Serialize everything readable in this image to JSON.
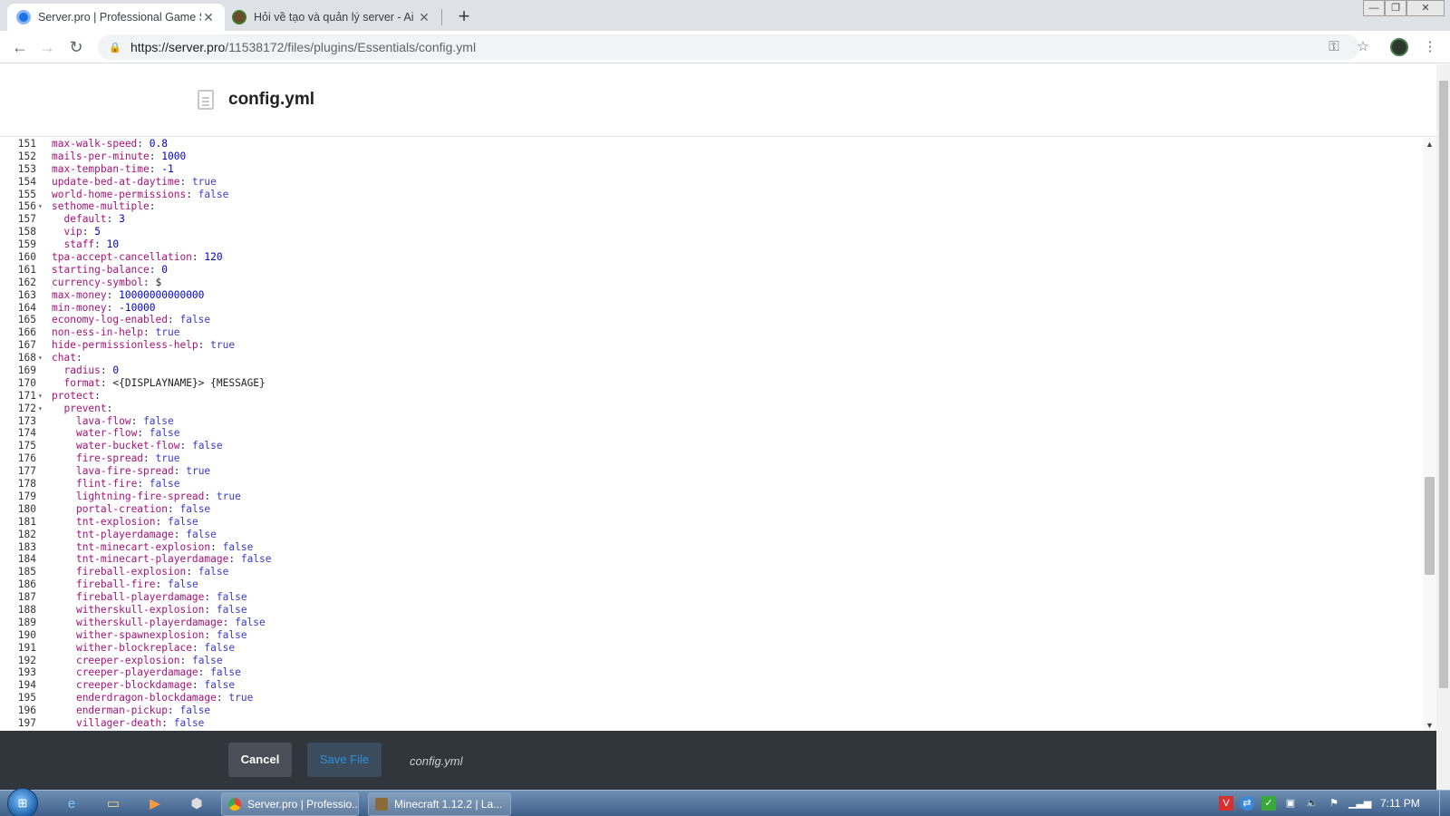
{
  "browser": {
    "tabs": [
      {
        "title": "Server.pro | Professional Game S",
        "active": true
      },
      {
        "title": "Hỏi về tạo và quản lý server - Ai",
        "active": false
      }
    ],
    "new_tab_icon": "plus-icon",
    "url_host": "https://server.pro",
    "url_path": "/11538172/files/plugins/Essentials/config.yml"
  },
  "page": {
    "file_title": "config.yml"
  },
  "editor": {
    "lines": [
      {
        "n": "151",
        "fold": "",
        "indent": "",
        "key": "max-walk-speed",
        "val": "0.8",
        "type": "num"
      },
      {
        "n": "152",
        "fold": "",
        "indent": "",
        "key": "mails-per-minute",
        "val": "1000",
        "type": "num"
      },
      {
        "n": "153",
        "fold": "",
        "indent": "",
        "key": "max-tempban-time",
        "val": "-1",
        "type": "num"
      },
      {
        "n": "154",
        "fold": "",
        "indent": "",
        "key": "update-bed-at-daytime",
        "val": "true",
        "type": "bool"
      },
      {
        "n": "155",
        "fold": "",
        "indent": "",
        "key": "world-home-permissions",
        "val": "false",
        "type": "bool"
      },
      {
        "n": "156",
        "fold": "▾",
        "indent": "",
        "key": "sethome-multiple",
        "val": "",
        "type": "none"
      },
      {
        "n": "157",
        "fold": "",
        "indent": "  ",
        "key": "default",
        "val": "3",
        "type": "num"
      },
      {
        "n": "158",
        "fold": "",
        "indent": "  ",
        "key": "vip",
        "val": "5",
        "type": "num"
      },
      {
        "n": "159",
        "fold": "",
        "indent": "  ",
        "key": "staff",
        "val": "10",
        "type": "num"
      },
      {
        "n": "160",
        "fold": "",
        "indent": "",
        "key": "tpa-accept-cancellation",
        "val": "120",
        "type": "num"
      },
      {
        "n": "161",
        "fold": "",
        "indent": "",
        "key": "starting-balance",
        "val": "0",
        "type": "num"
      },
      {
        "n": "162",
        "fold": "",
        "indent": "",
        "key": "currency-symbol",
        "val": "$",
        "type": "str"
      },
      {
        "n": "163",
        "fold": "",
        "indent": "",
        "key": "max-money",
        "val": "10000000000000",
        "type": "num"
      },
      {
        "n": "164",
        "fold": "",
        "indent": "",
        "key": "min-money",
        "val": "-10000",
        "type": "num"
      },
      {
        "n": "165",
        "fold": "",
        "indent": "",
        "key": "economy-log-enabled",
        "val": "false",
        "type": "bool"
      },
      {
        "n": "166",
        "fold": "",
        "indent": "",
        "key": "non-ess-in-help",
        "val": "true",
        "type": "bool"
      },
      {
        "n": "167",
        "fold": "",
        "indent": "",
        "key": "hide-permissionless-help",
        "val": "true",
        "type": "bool"
      },
      {
        "n": "168",
        "fold": "▾",
        "indent": "",
        "key": "chat",
        "val": "",
        "type": "none"
      },
      {
        "n": "169",
        "fold": "",
        "indent": "  ",
        "key": "radius",
        "val": "0",
        "type": "num"
      },
      {
        "n": "170",
        "fold": "",
        "indent": "  ",
        "key": "format",
        "val": "<{DISPLAYNAME}> {MESSAGE}",
        "type": "str"
      },
      {
        "n": "171",
        "fold": "▾",
        "indent": "",
        "key": "protect",
        "val": "",
        "type": "none"
      },
      {
        "n": "172",
        "fold": "▾",
        "indent": "  ",
        "key": "prevent",
        "val": "",
        "type": "none"
      },
      {
        "n": "173",
        "fold": "",
        "indent": "    ",
        "key": "lava-flow",
        "val": "false",
        "type": "bool"
      },
      {
        "n": "174",
        "fold": "",
        "indent": "    ",
        "key": "water-flow",
        "val": "false",
        "type": "bool"
      },
      {
        "n": "175",
        "fold": "",
        "indent": "    ",
        "key": "water-bucket-flow",
        "val": "false",
        "type": "bool"
      },
      {
        "n": "176",
        "fold": "",
        "indent": "    ",
        "key": "fire-spread",
        "val": "true",
        "type": "bool"
      },
      {
        "n": "177",
        "fold": "",
        "indent": "    ",
        "key": "lava-fire-spread",
        "val": "true",
        "type": "bool"
      },
      {
        "n": "178",
        "fold": "",
        "indent": "    ",
        "key": "flint-fire",
        "val": "false",
        "type": "bool"
      },
      {
        "n": "179",
        "fold": "",
        "indent": "    ",
        "key": "lightning-fire-spread",
        "val": "true",
        "type": "bool"
      },
      {
        "n": "180",
        "fold": "",
        "indent": "    ",
        "key": "portal-creation",
        "val": "false",
        "type": "bool"
      },
      {
        "n": "181",
        "fold": "",
        "indent": "    ",
        "key": "tnt-explosion",
        "val": "false",
        "type": "bool"
      },
      {
        "n": "182",
        "fold": "",
        "indent": "    ",
        "key": "tnt-playerdamage",
        "val": "false",
        "type": "bool"
      },
      {
        "n": "183",
        "fold": "",
        "indent": "    ",
        "key": "tnt-minecart-explosion",
        "val": "false",
        "type": "bool"
      },
      {
        "n": "184",
        "fold": "",
        "indent": "    ",
        "key": "tnt-minecart-playerdamage",
        "val": "false",
        "type": "bool"
      },
      {
        "n": "185",
        "fold": "",
        "indent": "    ",
        "key": "fireball-explosion",
        "val": "false",
        "type": "bool"
      },
      {
        "n": "186",
        "fold": "",
        "indent": "    ",
        "key": "fireball-fire",
        "val": "false",
        "type": "bool"
      },
      {
        "n": "187",
        "fold": "",
        "indent": "    ",
        "key": "fireball-playerdamage",
        "val": "false",
        "type": "bool"
      },
      {
        "n": "188",
        "fold": "",
        "indent": "    ",
        "key": "witherskull-explosion",
        "val": "false",
        "type": "bool"
      },
      {
        "n": "189",
        "fold": "",
        "indent": "    ",
        "key": "witherskull-playerdamage",
        "val": "false",
        "type": "bool"
      },
      {
        "n": "190",
        "fold": "",
        "indent": "    ",
        "key": "wither-spawnexplosion",
        "val": "false",
        "type": "bool"
      },
      {
        "n": "191",
        "fold": "",
        "indent": "    ",
        "key": "wither-blockreplace",
        "val": "false",
        "type": "bool"
      },
      {
        "n": "192",
        "fold": "",
        "indent": "    ",
        "key": "creeper-explosion",
        "val": "false",
        "type": "bool"
      },
      {
        "n": "193",
        "fold": "",
        "indent": "    ",
        "key": "creeper-playerdamage",
        "val": "false",
        "type": "bool"
      },
      {
        "n": "194",
        "fold": "",
        "indent": "    ",
        "key": "creeper-blockdamage",
        "val": "false",
        "type": "bool"
      },
      {
        "n": "195",
        "fold": "",
        "indent": "    ",
        "key": "enderdragon-blockdamage",
        "val": "true",
        "type": "bool"
      },
      {
        "n": "196",
        "fold": "",
        "indent": "    ",
        "key": "enderman-pickup",
        "val": "false",
        "type": "bool"
      },
      {
        "n": "197",
        "fold": "",
        "indent": "    ",
        "key": "villager-death",
        "val": "false",
        "type": "bool"
      }
    ]
  },
  "footer": {
    "cancel_label": "Cancel",
    "save_label": "Save File",
    "file_name": "config.yml"
  },
  "taskbar": {
    "tasks": [
      {
        "label": "Server.pro | Professio...",
        "icon": "chrome-icon"
      },
      {
        "label": "Minecraft 1.12.2 | La...",
        "icon": "minecraft-icon"
      }
    ],
    "clock": "7:11 PM"
  },
  "colors": {
    "yaml_key": "#a7117a",
    "yaml_number": "#0000cd",
    "yaml_bool": "#3a3acc",
    "footer_bg": "#31363d",
    "save_text": "#2e90d8"
  }
}
